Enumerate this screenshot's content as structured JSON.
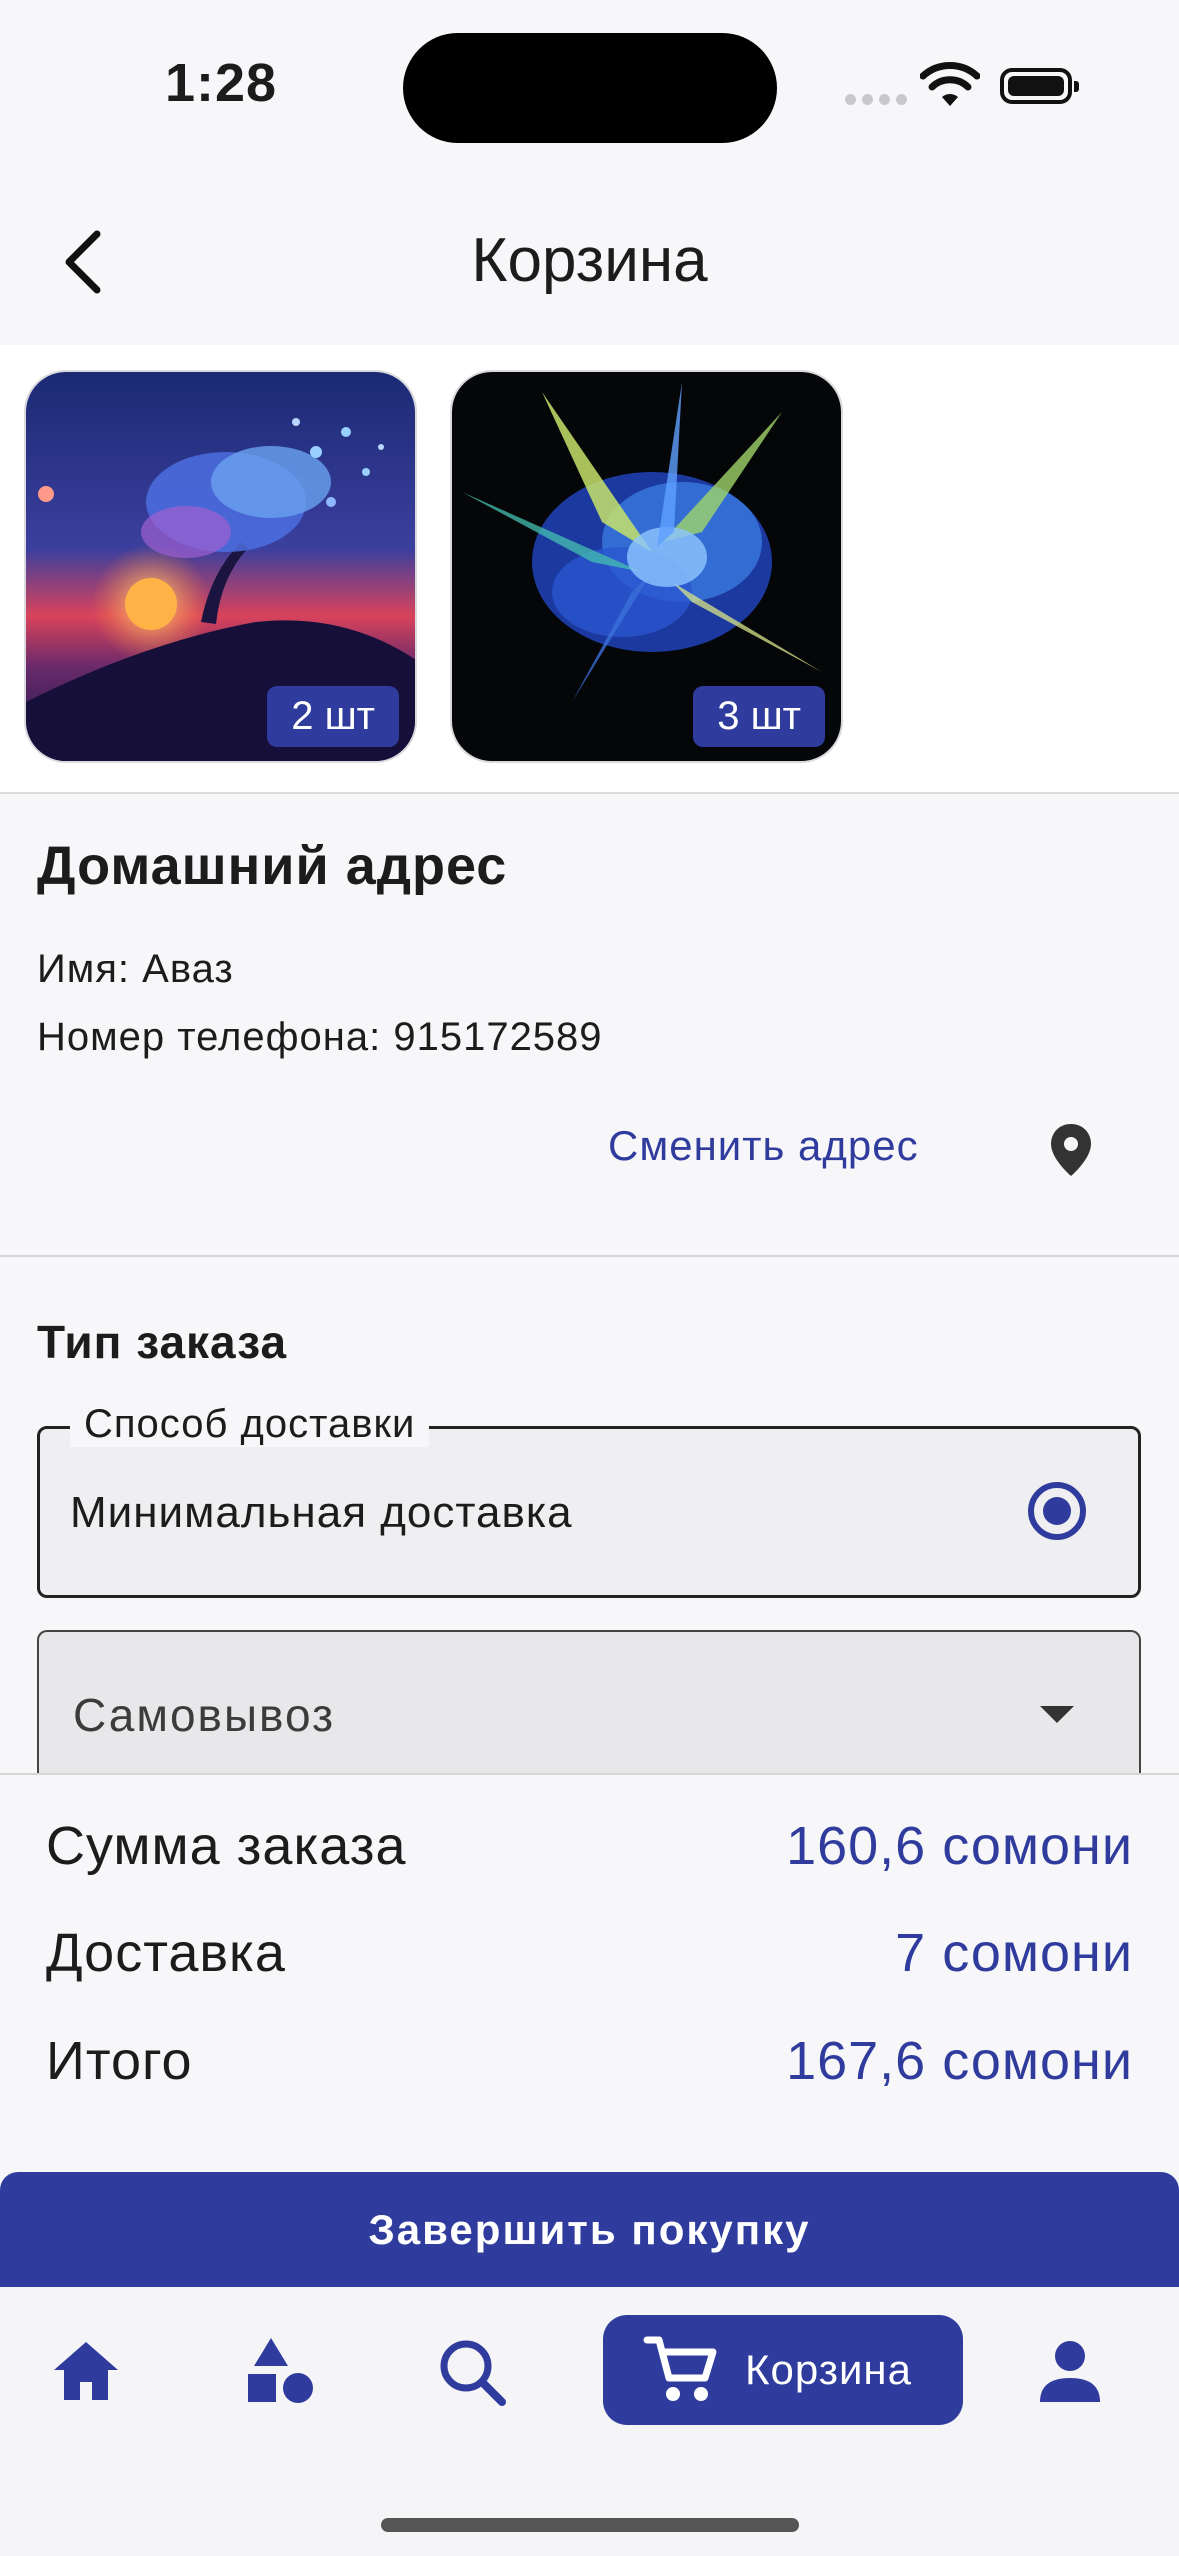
{
  "status_bar": {
    "time": "1:28"
  },
  "header": {
    "title": "Корзина"
  },
  "products": [
    {
      "quantity": "2 шт"
    },
    {
      "quantity": "3 шт"
    }
  ],
  "address": {
    "title": "Домашний адрес",
    "name_line": "Имя: Аваз",
    "phone_line": "Номер телефона: 915172589",
    "change_label": "Сменить адрес"
  },
  "order_type": {
    "title": "Тип заказа",
    "delivery_legend": "Способ доставки",
    "delivery_value": "Минимальная доставка",
    "pickup_value": "Самовывоз"
  },
  "summary": {
    "order_sum_label": "Сумма заказа",
    "order_sum_value": "160,6 сомони",
    "delivery_label": "Доставка",
    "delivery_value": "7 сомони",
    "total_label": "Итого",
    "total_value": "167,6 сомони"
  },
  "finish_button": "Завершить покупку",
  "nav": {
    "cart_label": "Корзина"
  },
  "colors": {
    "accent": "#2f3c9d",
    "background": "#f7f7f9"
  }
}
